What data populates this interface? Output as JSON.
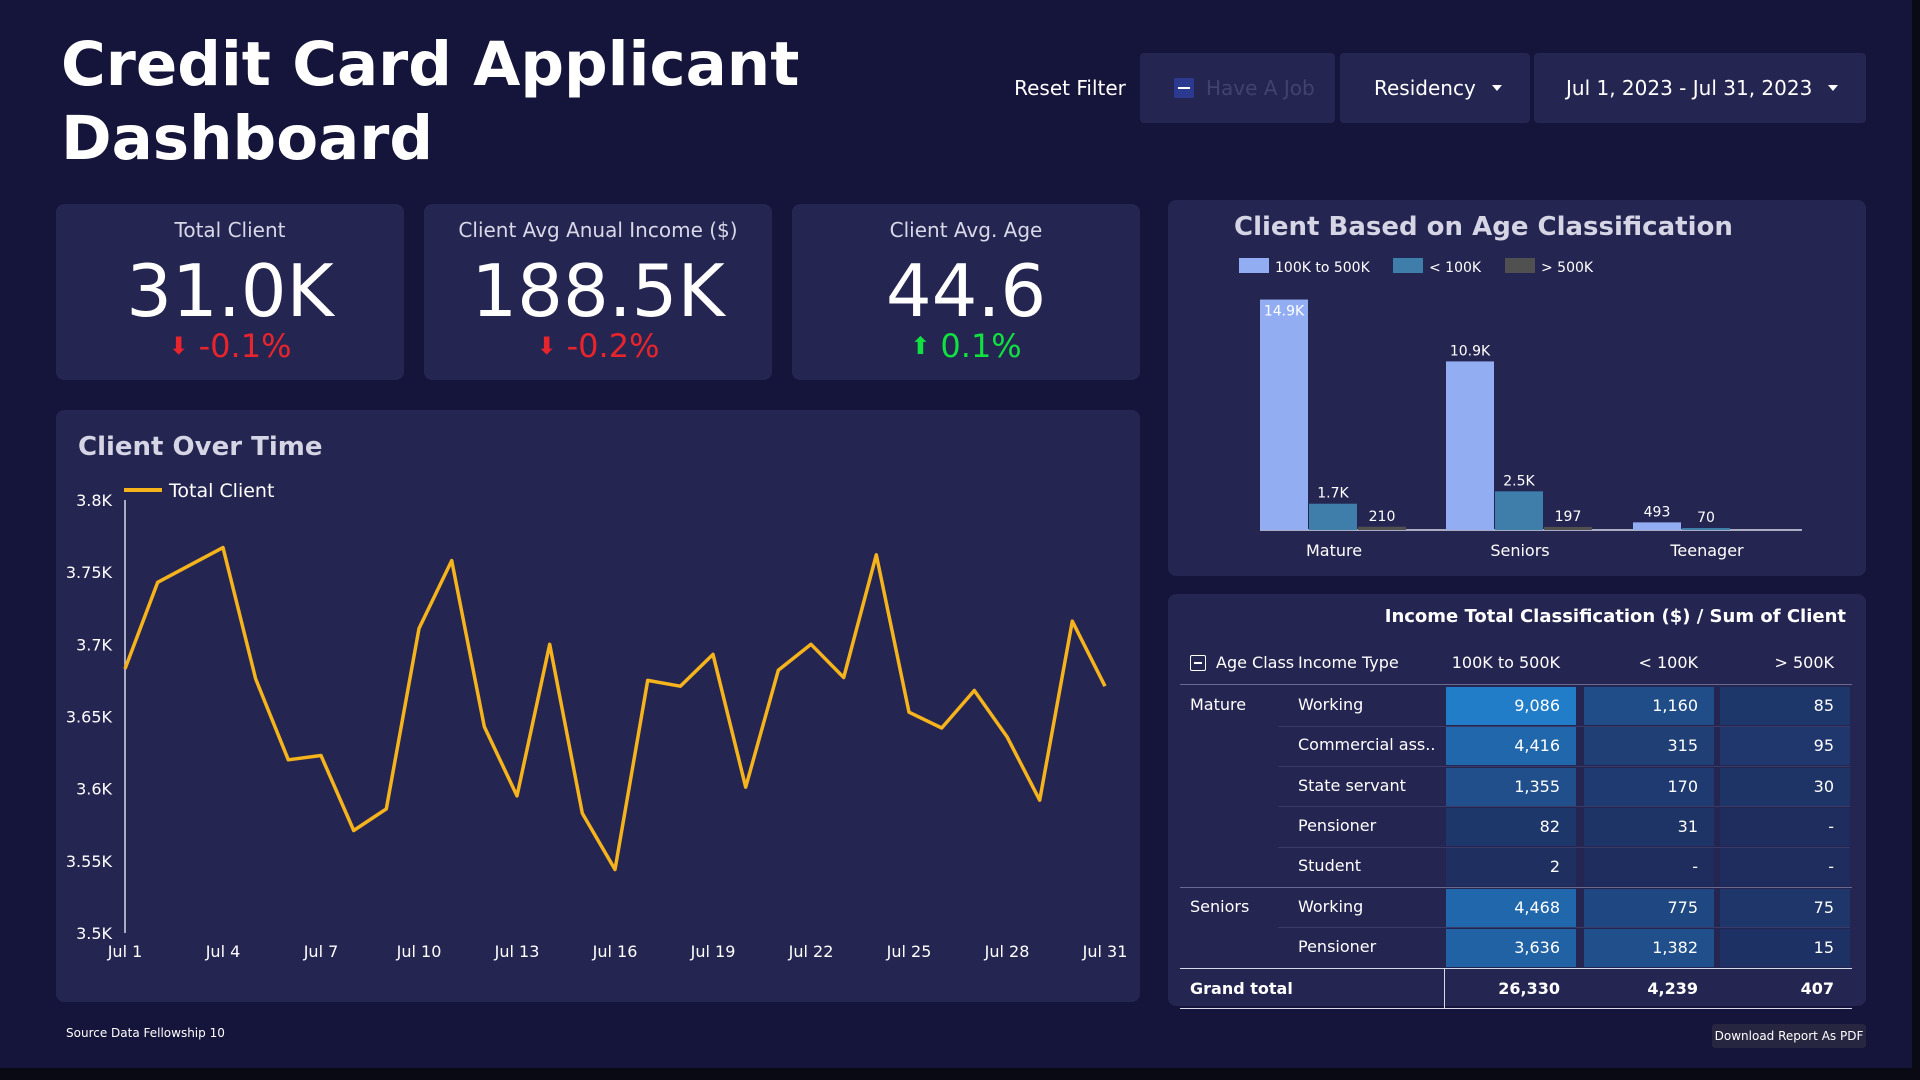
{
  "title": "Credit Card Applicant Dashboard",
  "filters": {
    "reset_label": "Reset Filter",
    "job_label": "Have A Job",
    "residency_label": "Residency",
    "date_range": "Jul 1, 2023 - Jul 31, 2023"
  },
  "kpis": [
    {
      "label": "Total Client",
      "value": "31.0K",
      "change": "-0.1%",
      "direction": "down"
    },
    {
      "label": "Client Avg Anual Income ($)",
      "value": "188.5K",
      "change": "-0.2%",
      "direction": "down"
    },
    {
      "label": "Client Avg. Age",
      "value": "44.6",
      "change": "0.1%",
      "direction": "up"
    }
  ],
  "colors": {
    "background": "#15143a",
    "card": "#252551",
    "line": "#f5b31c",
    "bar_100k_500k": "#93adf2",
    "bar_lt_100k": "#3f7dab",
    "bar_gt_500k": "#505050",
    "up": "#10e040",
    "down": "#e8242c"
  },
  "chart_data": [
    {
      "type": "line",
      "title": "Client Over Time",
      "series": [
        {
          "name": "Total Client",
          "values": [
            3683,
            3743,
            3755,
            3767,
            3676,
            3620,
            3623,
            3571,
            3586,
            3711,
            3758,
            3643,
            3595,
            3700,
            3583,
            3544,
            3675,
            3671,
            3693,
            3601,
            3682,
            3700,
            3677,
            3762,
            3653,
            3642,
            3668,
            3636,
            3592,
            3716,
            3671
          ]
        }
      ],
      "x": [
        "Jul 1",
        "Jul 2",
        "Jul 3",
        "Jul 4",
        "Jul 5",
        "Jul 6",
        "Jul 7",
        "Jul 8",
        "Jul 9",
        "Jul 10",
        "Jul 11",
        "Jul 12",
        "Jul 13",
        "Jul 14",
        "Jul 15",
        "Jul 16",
        "Jul 17",
        "Jul 18",
        "Jul 19",
        "Jul 20",
        "Jul 21",
        "Jul 22",
        "Jul 23",
        "Jul 24",
        "Jul 25",
        "Jul 26",
        "Jul 27",
        "Jul 28",
        "Jul 29",
        "Jul 30",
        "Jul 31"
      ],
      "x_tick_labels": [
        "Jul 1",
        "Jul 4",
        "Jul 7",
        "Jul 10",
        "Jul 13",
        "Jul 16",
        "Jul 19",
        "Jul 22",
        "Jul 25",
        "Jul 28",
        "Jul 31"
      ],
      "y_tick_values": [
        3500,
        3550,
        3600,
        3650,
        3700,
        3750,
        3800
      ],
      "y_tick_labels": [
        "3.5K",
        "3.55K",
        "3.6K",
        "3.65K",
        "3.7K",
        "3.75K",
        "3.8K"
      ],
      "ylim": [
        3500,
        3800
      ],
      "legend": "top-left",
      "grid": false
    },
    {
      "type": "bar",
      "title": "Client Based on Age Classification",
      "categories": [
        "Mature",
        "Seniors",
        "Teenager"
      ],
      "series": [
        {
          "name": "100K to 500K",
          "values": [
            14900,
            10900,
            493
          ],
          "labels": [
            "14.9K",
            "10.9K",
            "493"
          ]
        },
        {
          "name": "< 100K",
          "values": [
            1700,
            2500,
            70
          ],
          "labels": [
            "1.7K",
            "2.5K",
            "70"
          ]
        },
        {
          "name": "> 500K",
          "values": [
            210,
            197,
            0
          ],
          "labels": [
            "210",
            "197",
            ""
          ]
        }
      ],
      "ylim": [
        0,
        15000
      ],
      "legend": "top-left",
      "grid": false
    },
    {
      "type": "table",
      "title": "Income Total Classification ($) / Sum of Client",
      "row_headers": [
        "Age Class",
        "Income Type"
      ],
      "columns": [
        "100K to 500K",
        "< 100K",
        "> 500K"
      ],
      "rows": [
        {
          "age": "Mature",
          "type": "Working",
          "values": [
            "9,086",
            "1,160",
            "85"
          ],
          "shade": [
            9086,
            1160,
            85
          ]
        },
        {
          "age": "",
          "type": "Commercial ass...",
          "values": [
            "4,416",
            "315",
            "95"
          ],
          "shade": [
            4416,
            315,
            95
          ]
        },
        {
          "age": "",
          "type": "State servant",
          "values": [
            "1,355",
            "170",
            "30"
          ],
          "shade": [
            1355,
            170,
            30
          ]
        },
        {
          "age": "",
          "type": "Pensioner",
          "values": [
            "82",
            "31",
            "-"
          ],
          "shade": [
            82,
            31,
            0
          ]
        },
        {
          "age": "",
          "type": "Student",
          "values": [
            "2",
            "-",
            "-"
          ],
          "shade": [
            2,
            0,
            0
          ]
        },
        {
          "age": "Seniors",
          "type": "Working",
          "values": [
            "4,468",
            "775",
            "75"
          ],
          "shade": [
            4468,
            775,
            75
          ]
        },
        {
          "age": "",
          "type": "Pensioner",
          "values": [
            "3,636",
            "1,382",
            "15"
          ],
          "shade": [
            3636,
            1382,
            15
          ]
        }
      ],
      "total_label": "Grand total",
      "totals": [
        "26,330",
        "4,239",
        "407"
      ]
    }
  ],
  "footer": {
    "source": "Source Data Fellowship 10",
    "download_label": "Download Report As PDF"
  }
}
